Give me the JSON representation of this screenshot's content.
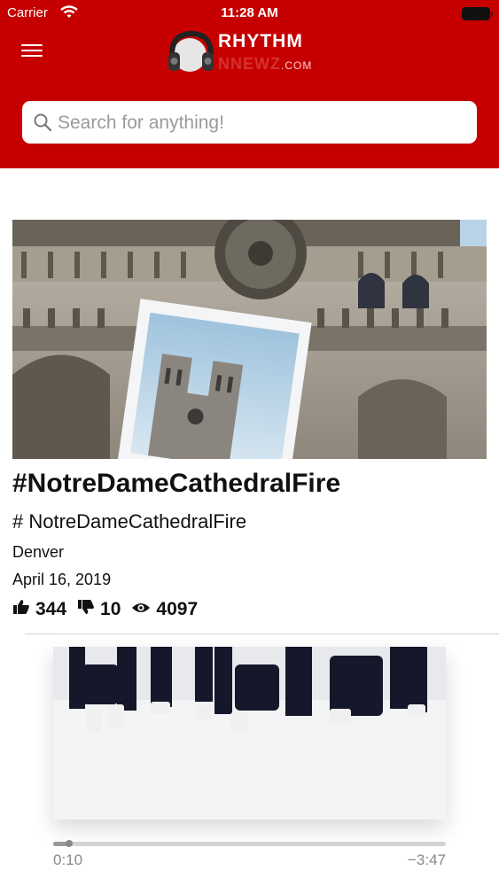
{
  "status_bar": {
    "carrier": "Carrier",
    "time": "11:28 AM"
  },
  "header": {
    "logo_title": "RHYTHM",
    "logo_sub": "NNEWZ",
    "logo_domain": ".COM",
    "brand_color": "#c60000"
  },
  "search": {
    "placeholder": "Search for anything!"
  },
  "post": {
    "title": "#NotreDameCathedralFire",
    "subtitle": "# NotreDameCathedralFire",
    "location": "Denver",
    "date": "April 16, 2019",
    "likes": "344",
    "dislikes": "10",
    "views": "4097"
  },
  "player": {
    "elapsed": "0:10",
    "remaining": "−3:47",
    "progress_fraction": 0.04
  },
  "icons": {
    "menu": "menu-icon",
    "search": "search-icon",
    "like": "thumbs-up-icon",
    "dislike": "thumbs-down-icon",
    "views": "eye-icon"
  }
}
